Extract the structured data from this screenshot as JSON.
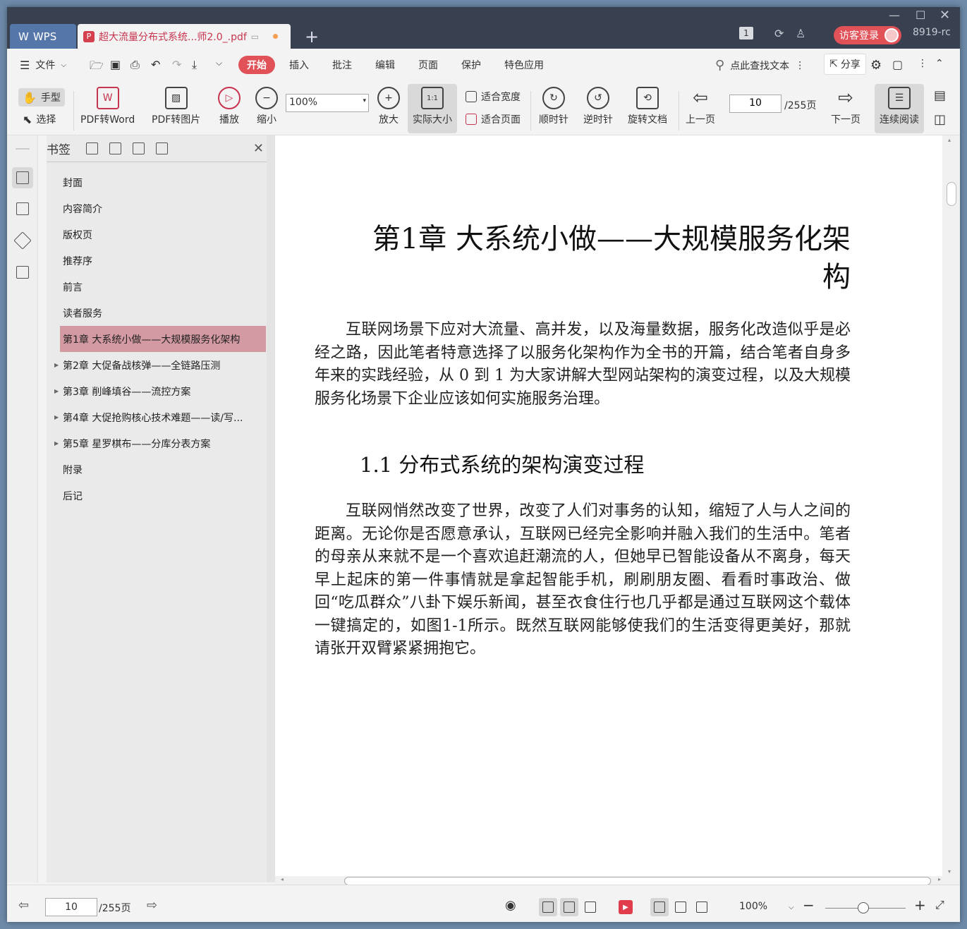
{
  "titlebar": {
    "app_tab": "WPS",
    "doc_tab": "超大流量分布式系统...师2.0_.pdf",
    "badge": "1",
    "login": "访客登录",
    "user": "8919-rc"
  },
  "menu": {
    "file": "文件",
    "tabs": [
      "开始",
      "插入",
      "批注",
      "编辑",
      "页面",
      "保护",
      "特色应用"
    ],
    "search": "点此查找文本",
    "share": "分享"
  },
  "ribbon": {
    "hand": "手型",
    "select": "选择",
    "pdf_to_word": "PDF转Word",
    "pdf_to_image": "PDF转图片",
    "play": "播放",
    "zoom_out": "缩小",
    "zoom_value": "100%",
    "zoom_in": "放大",
    "actual_size": "实际大小",
    "fit_width": "适合宽度",
    "fit_page": "适合页面",
    "clockwise": "顺时针",
    "counter_clockwise": "逆时针",
    "rotate_doc": "旋转文档",
    "prev_page": "上一页",
    "page_current": "10",
    "page_total": "/255页",
    "next_page": "下一页",
    "continuous": "连续阅读"
  },
  "bookmarks": {
    "title": "书签",
    "items": [
      {
        "label": "封面"
      },
      {
        "label": "内容简介"
      },
      {
        "label": "版权页"
      },
      {
        "label": "推荐序"
      },
      {
        "label": "前言"
      },
      {
        "label": "读者服务"
      },
      {
        "label": "第1章 大系统小做——大规模服务化架构"
      },
      {
        "label": "第2章 大促备战核弹——全链路压测"
      },
      {
        "label": "第3章 削峰填谷——流控方案"
      },
      {
        "label": "第4章 大促抢购核心技术难题——读/写..."
      },
      {
        "label": "第5章 星罗棋布——分库分表方案"
      },
      {
        "label": "附录"
      },
      {
        "label": "后记"
      }
    ]
  },
  "document": {
    "chapter_title_line1": "第1章  大系统小做——大规模服务化架",
    "chapter_title_line2": "构",
    "para1": "互联网场景下应对大流量、高并发，以及海量数据，服务化改造似乎是必经之路，因此笔者特意选择了以服务化架构作为全书的开篇，结合笔者自身多年来的实践经验，从 0 到 1 为大家讲解大型网站架构的演变过程，以及大规模服务化场景下企业应该如何实施服务治理。",
    "section_title": "1.1  分布式系统的架构演变过程",
    "para2": "互联网悄然改变了世界，改变了人们对事务的认知，缩短了人与人之间的距离。无论你是否愿意承认，互联网已经完全影响并融入我们的生活中。笔者的母亲从来就不是一个喜欢追赶潮流的人，但她早已智能设备从不离身，每天早上起床的第一件事情就是拿起智能手机，刷刷朋友圈、看看时事政治、做回“吃瓜群众”八卦下娱乐新闻，甚至衣食住行也几乎都是通过互联网这个载体一键搞定的，如图1-1所示。既然互联网能够使我们的生活变得更美好，那就请张开双臂紧紧拥抱它。"
  },
  "statusbar": {
    "page_current": "10",
    "page_total": "/255页",
    "zoom": "100%"
  },
  "colors": {
    "accent": "#e05158",
    "titlebar": "#394150",
    "bookmark_selected": "#d49aa4"
  }
}
